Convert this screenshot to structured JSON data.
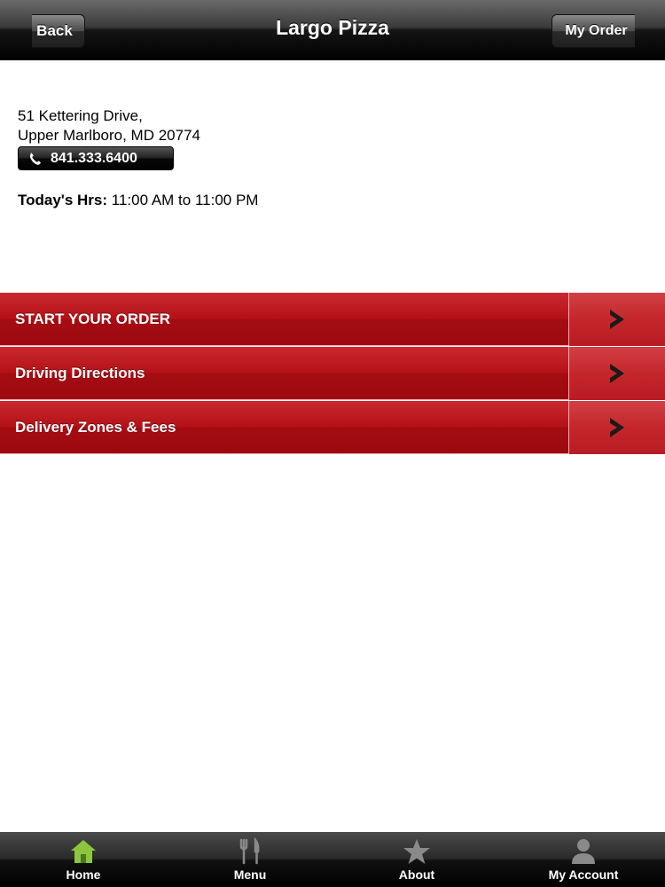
{
  "nav": {
    "title": "Largo Pizza",
    "back_label": "Back",
    "order_label": "My Order"
  },
  "location": {
    "address_line1": "51 Kettering Drive,",
    "address_line2": "Upper Marlboro, MD 20774",
    "phone": "841.333.6400",
    "hours_label": "Today's Hrs:",
    "hours_value": "11:00 AM to 11:00 PM"
  },
  "menu": {
    "items": [
      {
        "label": "START YOUR ORDER",
        "icon": "chevron-right-icon"
      },
      {
        "label": "Driving Directions",
        "icon": "chevron-right-icon"
      },
      {
        "label": "Delivery Zones & Fees",
        "icon": "chevron-right-icon"
      }
    ]
  },
  "tabbar": {
    "tabs": [
      {
        "label": "Home",
        "icon": "home-icon",
        "active": true
      },
      {
        "label": "Menu",
        "icon": "fork-knife-icon",
        "active": false
      },
      {
        "label": "About",
        "icon": "star-icon",
        "active": false
      },
      {
        "label": "My Account",
        "icon": "person-icon",
        "active": false
      }
    ]
  },
  "colors": {
    "row_red": "#a50c12",
    "active_tab_green": "#8cc63f",
    "inactive_tab_gray": "#8a8a8a"
  }
}
